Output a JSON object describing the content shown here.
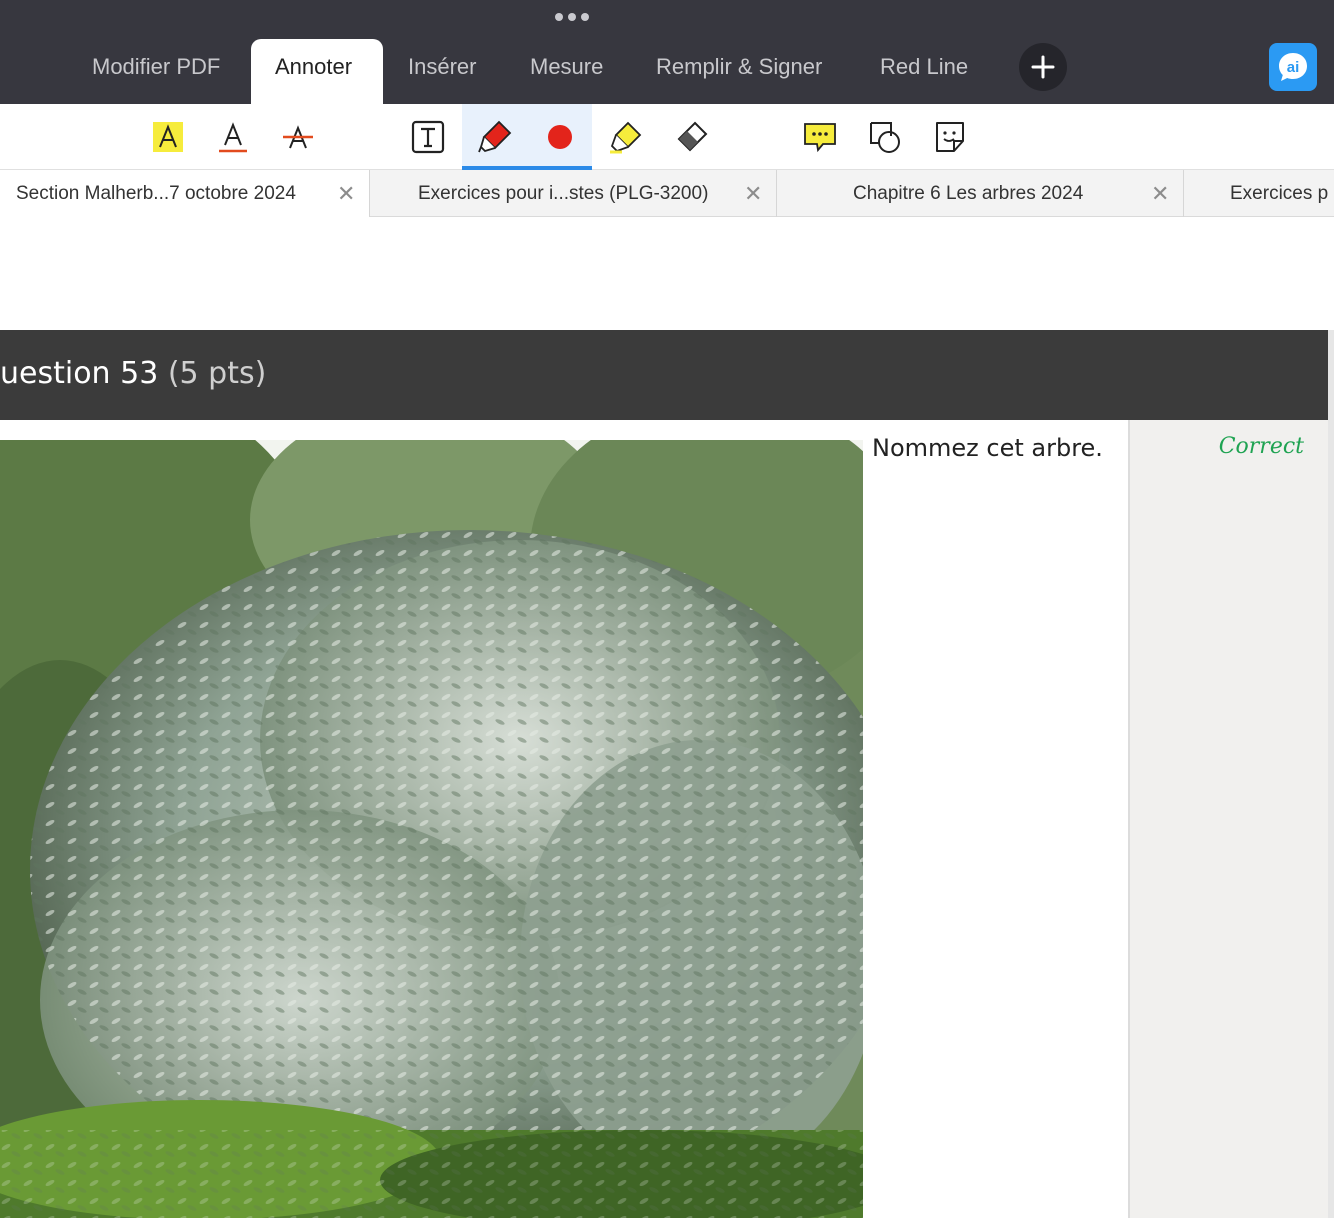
{
  "topbar": {
    "tabs": [
      {
        "label": "Modifier PDF"
      },
      {
        "label": "Annoter"
      },
      {
        "label": "Insérer"
      },
      {
        "label": "Mesure"
      },
      {
        "label": "Remplir & Signer"
      },
      {
        "label": "Red Line"
      }
    ],
    "active_tab": "Annoter",
    "ai_label": "ai"
  },
  "tools": [
    {
      "icon": "text-highlight-icon"
    },
    {
      "icon": "text-underline-icon"
    },
    {
      "icon": "text-strikethrough-icon"
    },
    {
      "icon": "text-box-icon"
    },
    {
      "icon": "pen-icon",
      "selected": true
    },
    {
      "icon": "color-dot-icon",
      "selected": true,
      "color": "#e3241b"
    },
    {
      "icon": "highlighter-icon"
    },
    {
      "icon": "eraser-icon"
    },
    {
      "icon": "comment-icon"
    },
    {
      "icon": "shapes-icon"
    },
    {
      "icon": "sticker-icon"
    }
  ],
  "doc_tabs": [
    {
      "label": "Section Malherb...7 octobre 2024",
      "close": "✕"
    },
    {
      "label": "Exercices pour i...stes (PLG-3200)",
      "close": "✕"
    },
    {
      "label": "Chapitre 6 Les arbres  2024",
      "close": "✕"
    },
    {
      "label": "Exercices p"
    }
  ],
  "question": {
    "title": "uestion 53",
    "points": "(5 pts)",
    "prompt": "Nommez cet arbre.",
    "status": "Correct"
  },
  "colors": {
    "topbar": "#37373f",
    "accent": "#2b8ae8",
    "correct": "#1fa352",
    "question_header": "#3b3b3b"
  }
}
